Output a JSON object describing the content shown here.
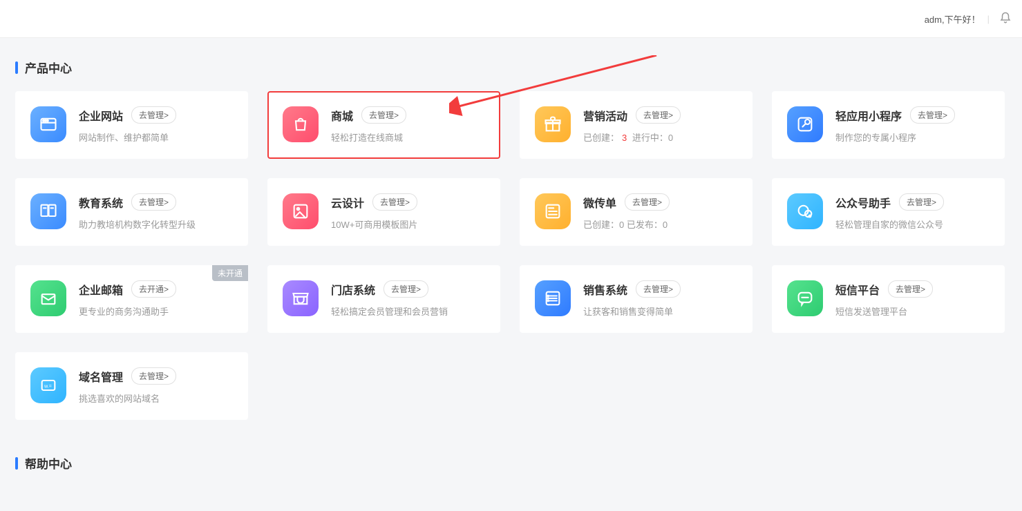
{
  "header": {
    "greeting": "adm,下午好！"
  },
  "sections": {
    "products_title": "产品中心",
    "help_title": "帮助中心"
  },
  "cards": [
    {
      "title": "企业网站",
      "btn": "去管理>",
      "sub": "网站制作、维护都简单",
      "icon": "window",
      "bg": "#3a8bff",
      "bg2": "#6bb0ff"
    },
    {
      "title": "商城",
      "btn": "去管理>",
      "sub": "轻松打造在线商城",
      "icon": "bag",
      "bg": "#ff4d6d",
      "bg2": "#ff7a8a",
      "hl": true
    },
    {
      "title": "营销活动",
      "btn": "去管理>",
      "sub_parts": [
        {
          "t": "已创建："
        },
        {
          "t": "3",
          "red": true
        },
        {
          "t": "   进行中：0"
        }
      ],
      "icon": "gift",
      "bg": "#ffb02e",
      "bg2": "#ffc85a"
    },
    {
      "title": "轻应用小程序",
      "btn": "去管理>",
      "sub": "制作您的专属小程序",
      "icon": "link",
      "bg": "#2f7bff",
      "bg2": "#56a0ff"
    },
    {
      "title": "教育系统",
      "btn": "去管理>",
      "sub": "助力教培机构数字化转型升级",
      "icon": "book",
      "bg": "#3a8bff",
      "bg2": "#6bb0ff"
    },
    {
      "title": "云设计",
      "btn": "去管理>",
      "sub": "10W+可商用模板图片",
      "icon": "image",
      "bg": "#ff4d6d",
      "bg2": "#ff7a8a"
    },
    {
      "title": "微传单",
      "btn": "去管理>",
      "sub_parts": [
        {
          "t": "已创建：0   已发布：0"
        }
      ],
      "icon": "news",
      "bg": "#ffb02e",
      "bg2": "#ffc85a"
    },
    {
      "title": "公众号助手",
      "btn": "去管理>",
      "sub": "轻松管理自家的微信公众号",
      "icon": "wechat",
      "bg": "#2fb4ff",
      "bg2": "#5ccaff"
    },
    {
      "title": "企业邮箱",
      "btn": "去开通>",
      "sub": "更专业的商务沟通助手",
      "icon": "mail",
      "bg": "#2ecc71",
      "bg2": "#55e28e",
      "badge": "未开通"
    },
    {
      "title": "门店系统",
      "btn": "去管理>",
      "sub": "轻松搞定会员管理和会员营销",
      "icon": "store",
      "bg": "#8a63ff",
      "bg2": "#a98aff"
    },
    {
      "title": "销售系统",
      "btn": "去管理>",
      "sub": "让获客和销售变得简单",
      "icon": "list",
      "bg": "#2f7bff",
      "bg2": "#56a0ff"
    },
    {
      "title": "短信平台",
      "btn": "去管理>",
      "sub": "短信发送管理平台",
      "icon": "msg",
      "bg": "#2ecc71",
      "bg2": "#55e28e"
    },
    {
      "title": "域名管理",
      "btn": "去管理>",
      "sub": "挑选喜欢的网站域名",
      "icon": "domain",
      "bg": "#2fb4ff",
      "bg2": "#5ccaff"
    }
  ]
}
